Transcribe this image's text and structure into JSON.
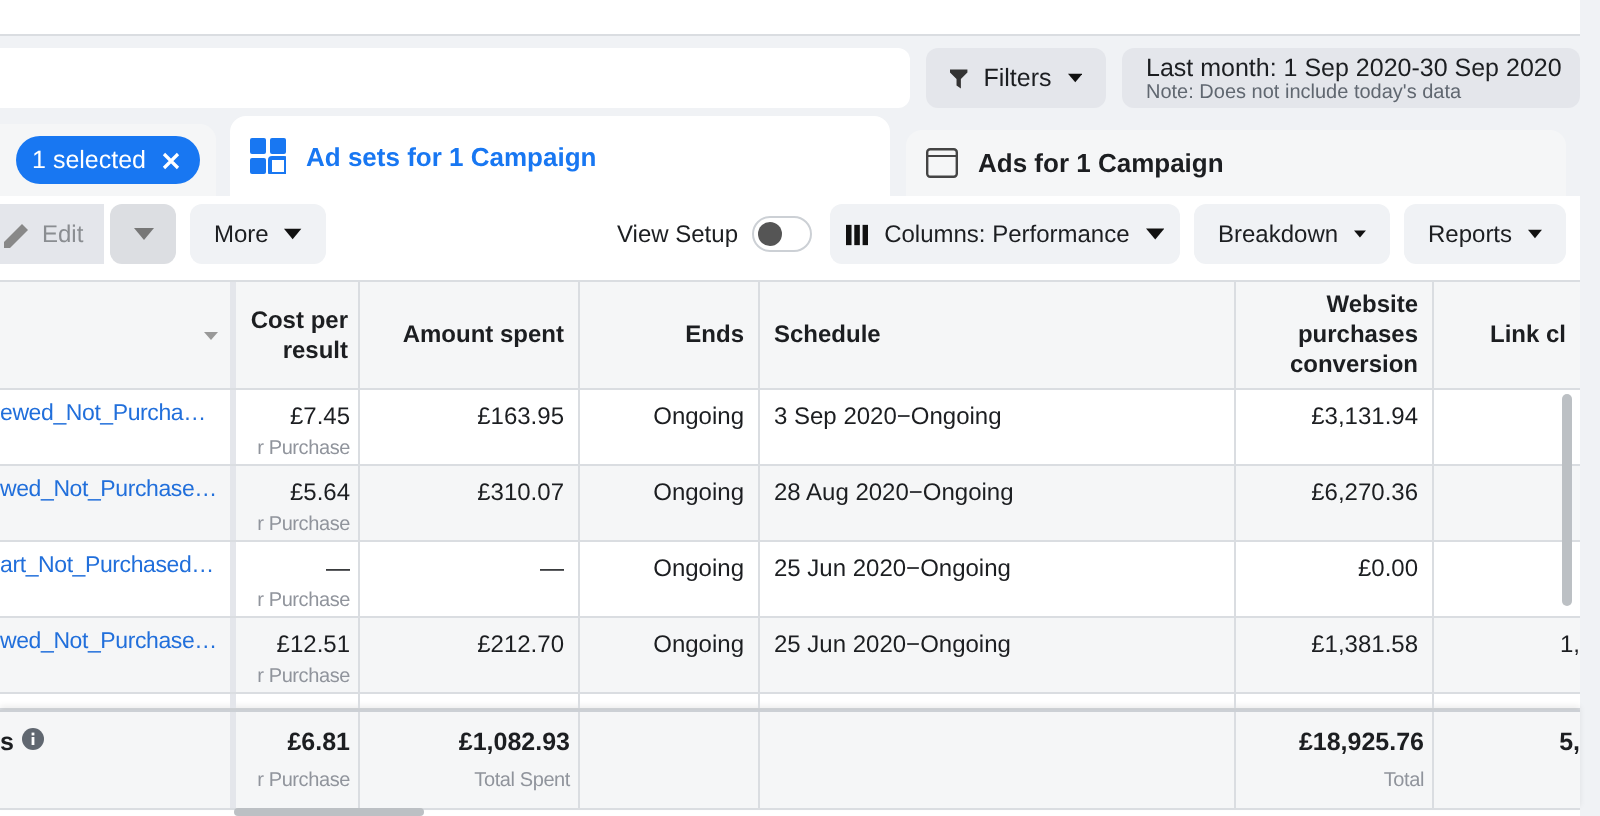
{
  "filters_button": {
    "label": "Filters"
  },
  "date_range": {
    "label": "Last month: 1 Sep 2020-30 Sep 2020",
    "note": "Note: Does not include today's data"
  },
  "selection_chip": {
    "label": "1 selected"
  },
  "tabs": [
    {
      "label": "Ad sets for 1 Campaign",
      "selected": true,
      "kind": "adsets"
    },
    {
      "label": "Ads for 1 Campaign",
      "selected": false,
      "kind": "ads"
    }
  ],
  "toolbar": {
    "edit": "Edit",
    "more": "More",
    "view_setup": {
      "label": "View Setup",
      "on": false
    },
    "columns": "Columns: Performance",
    "breakdown": "Breakdown",
    "reports": "Reports"
  },
  "table": {
    "columns": [
      "Cost per result",
      "Amount spent",
      "Ends",
      "Schedule",
      "Website purchases conversion",
      "Link cl"
    ],
    "rows": [
      {
        "name": "ewed_Not_Purcha…",
        "cost": "£7.45",
        "cost_sub": "r Purchase",
        "amount": "£163.95",
        "ends": "Ongoing",
        "schedule": "3 Sep 2020−Ongoing",
        "website": "£3,131.94",
        "link": ""
      },
      {
        "name": "wed_Not_Purchase…",
        "cost": "£5.64",
        "cost_sub": "r Purchase",
        "amount": "£310.07",
        "ends": "Ongoing",
        "schedule": "28 Aug 2020−Ongoing",
        "website": "£6,270.36",
        "link": ""
      },
      {
        "name": "art_Not_Purchased…",
        "cost": "—",
        "cost_sub": "r Purchase",
        "amount": "—",
        "ends": "Ongoing",
        "schedule": "25 Jun 2020−Ongoing",
        "website": "£0.00",
        "link": ""
      },
      {
        "name": "wed_Not_Purchase…",
        "cost": "£12.51",
        "cost_sub": "r Purchase",
        "amount": "£212.70",
        "ends": "Ongoing",
        "schedule": "25 Jun 2020−Ongoing",
        "website": "£1,381.58",
        "link": "1,"
      }
    ],
    "summary": {
      "name": "s",
      "cost": "£6.81",
      "cost_sub": "r Purchase",
      "amount": "£1,082.93",
      "amount_sub": "Total Spent",
      "website": "£18,925.76",
      "website_sub": "Total",
      "link": "5,"
    }
  }
}
